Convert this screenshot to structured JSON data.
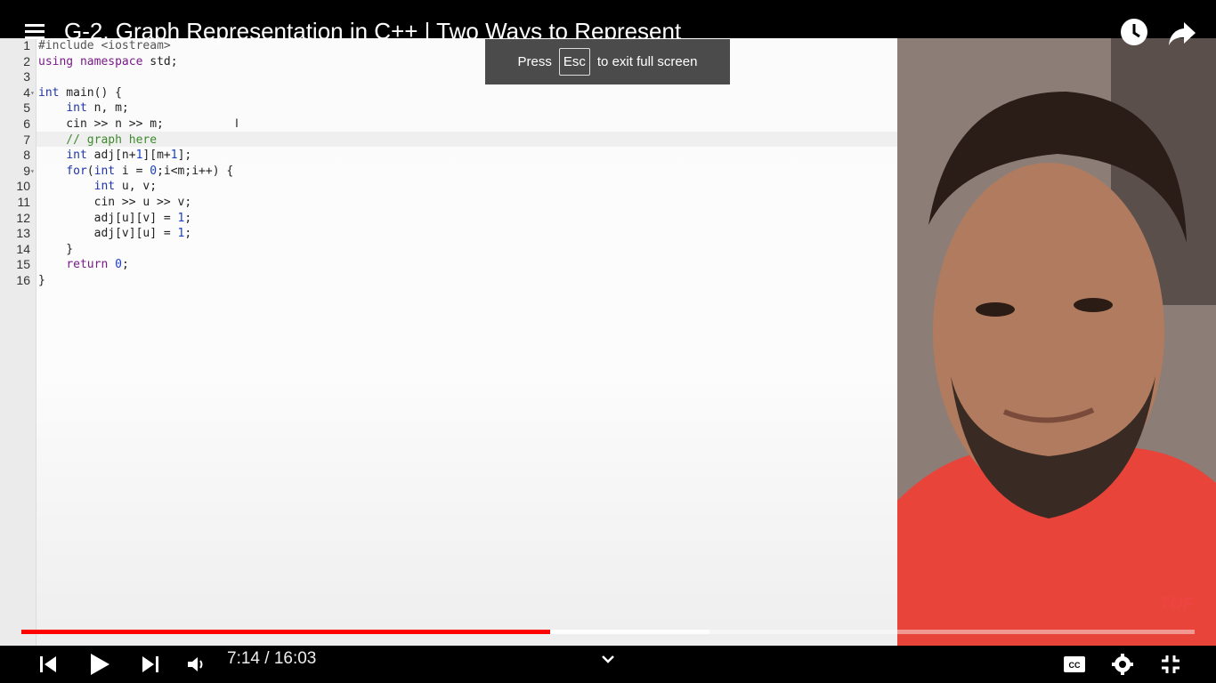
{
  "header": {
    "title": "G-2. Graph Representation in C++ | Two Ways to Represent"
  },
  "toast": {
    "prefix": "Press",
    "key": "Esc",
    "suffix": "to exit full screen"
  },
  "editor": {
    "lines": [
      {
        "n": "1",
        "code": "#include <iostream>"
      },
      {
        "n": "2",
        "code": "using namespace std;"
      },
      {
        "n": "3",
        "code": ""
      },
      {
        "n": "4",
        "code": "int main() {"
      },
      {
        "n": "5",
        "code": "    int n, m;"
      },
      {
        "n": "6",
        "code": "    cin >> n >> m;"
      },
      {
        "n": "7",
        "code": "    // graph here"
      },
      {
        "n": "8",
        "code": "    int adj[n+1][m+1];"
      },
      {
        "n": "9",
        "code": "    for(int i = 0;i<m;i++) {"
      },
      {
        "n": "10",
        "code": "        int u, v;"
      },
      {
        "n": "11",
        "code": "        cin >> u >> v;"
      },
      {
        "n": "12",
        "code": "        adj[u][v] = 1;"
      },
      {
        "n": "13",
        "code": "        adj[v][u] = 1;"
      },
      {
        "n": "14",
        "code": "    }"
      },
      {
        "n": "15",
        "code": "    return 0;"
      },
      {
        "n": "16",
        "code": "}"
      }
    ]
  },
  "watermark": "TUF",
  "player": {
    "time": "7:14 / 16:03",
    "progress_fraction": 0.4508,
    "buffered_fraction": 0.5862,
    "icons": [
      "menu-icon",
      "watch-later-icon",
      "share-icon",
      "previous-icon",
      "play-icon",
      "next-icon",
      "volume-icon",
      "chevron-down-icon",
      "subtitles-icon",
      "settings-icon",
      "exit-fullscreen-icon"
    ],
    "accent": "#ff0000"
  }
}
